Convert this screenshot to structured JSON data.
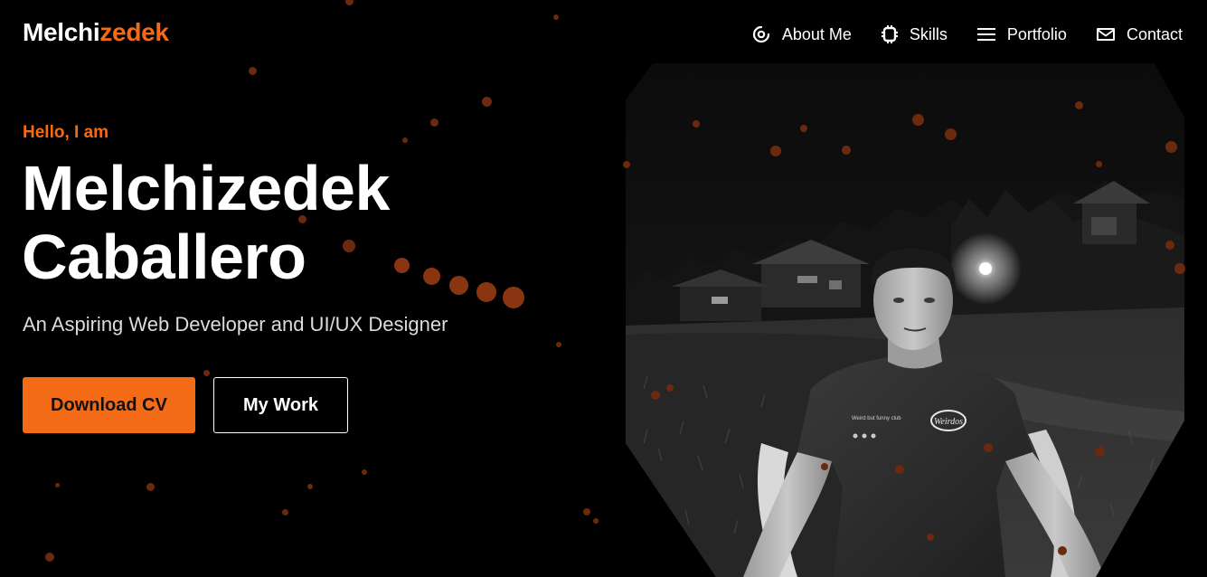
{
  "header": {
    "logo_part_a": "Melchi",
    "logo_part_b": "zedek",
    "nav": [
      {
        "label": "About Me",
        "icon": "target-icon"
      },
      {
        "label": "Skills",
        "icon": "chip-icon"
      },
      {
        "label": "Portfolio",
        "icon": "menu-lines-icon"
      },
      {
        "label": "Contact",
        "icon": "envelope-icon"
      }
    ]
  },
  "hero": {
    "greeting": "Hello, I am",
    "name_line1": "Melchizedek",
    "name_line2": "Caballero",
    "subtitle": "An Aspiring Web Developer and UI/UX Designer",
    "download_label": "Download CV",
    "work_label": "My Work"
  },
  "photo": {
    "shirt_logo_text": "Weirdos",
    "shirt_tag_text": "Weird but funny club"
  },
  "colors": {
    "accent": "#f36b16",
    "background": "#000000",
    "text": "#ffffff",
    "particle": "#6b2a0e"
  }
}
